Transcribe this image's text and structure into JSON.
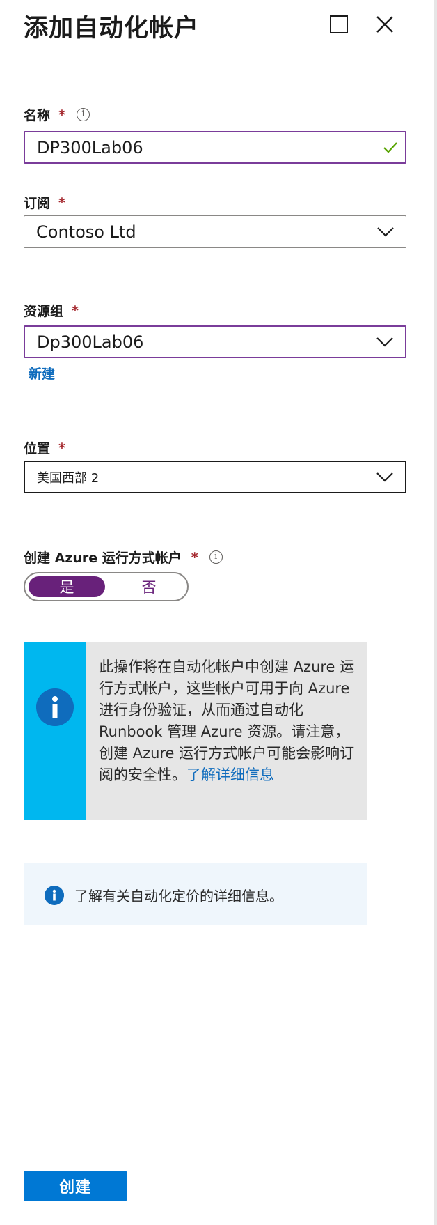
{
  "header": {
    "title": "添加自动化帐户",
    "maximize_icon": "maximize-icon",
    "close_icon": "close-icon"
  },
  "form": {
    "name": {
      "label": "名称",
      "required": "*",
      "value": "DP300Lab06",
      "valid": true
    },
    "subscription": {
      "label": "订阅",
      "required": "*",
      "value": "Contoso Ltd"
    },
    "resource_group": {
      "label": "资源组",
      "required": "*",
      "value": "Dp300Lab06",
      "new_link": "新建"
    },
    "location": {
      "label": "位置",
      "required": "*",
      "value": "美国西部 2"
    },
    "run_as": {
      "label": "创建 Azure 运行方式帐户",
      "required": "*",
      "options": [
        "是",
        "否"
      ],
      "selected": "是"
    }
  },
  "callout": {
    "text": "此操作将在自动化帐户中创建 Azure 运行方式帐户，这些帐户可用于向 Azure 进行身份验证，从而通过自动化 Runbook 管理 Azure 资源。请注意，创建 Azure 运行方式帐户可能会影响订阅的安全性。",
    "link": "了解详细信息"
  },
  "pricing_note": {
    "text": "了解有关自动化定价的详细信息。"
  },
  "footer": {
    "create_label": "创建"
  },
  "colors": {
    "accent_purple": "#68217a",
    "primary_blue": "#0078d4",
    "link_blue": "#0f6cbd",
    "callout_bar": "#00b7ef",
    "required_red": "#a4262c"
  }
}
